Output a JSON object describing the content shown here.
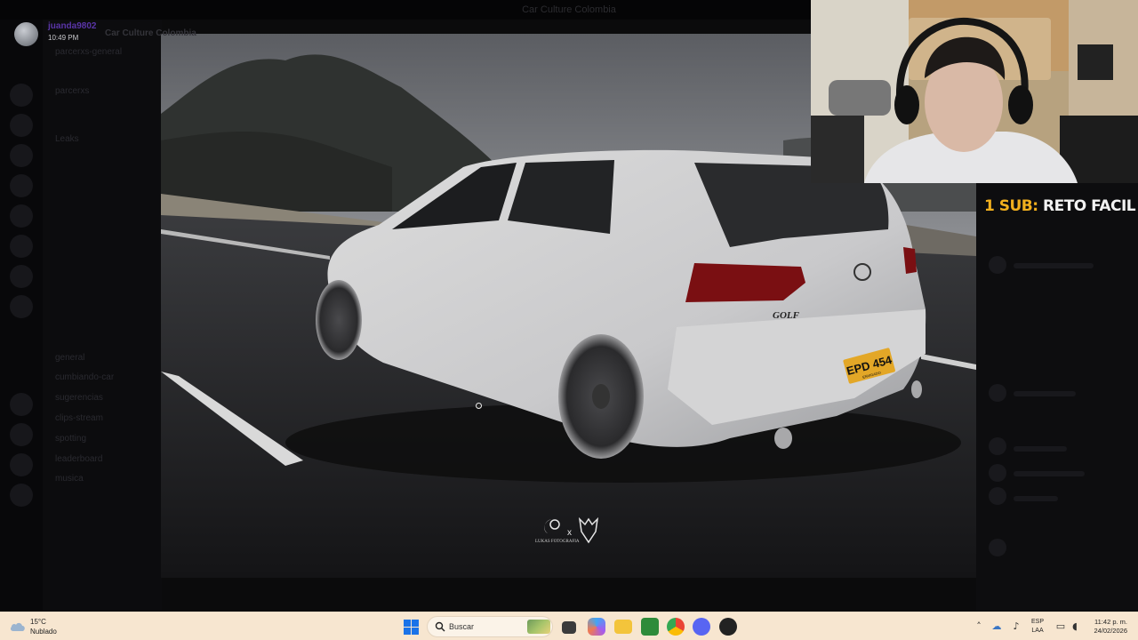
{
  "app": {
    "window_title": "Car Culture Colombia",
    "server_name": "Car Culture Colombia"
  },
  "user_header": {
    "username": "juanda9802",
    "time": "10:49 PM"
  },
  "channels": [
    "parcerxs-general",
    "parcerxs",
    "Leaks",
    "general",
    "cumbiando-car",
    "sugerencias",
    "clips-stream",
    "spotting",
    "leaderboard",
    "musica"
  ],
  "stream_overlay": {
    "sub_count": "1 SUB:",
    "sub_goal": "RETO FACIL"
  },
  "photo": {
    "watermark_left": "LUKAS\nFOTOGRAFIA",
    "watermark_sep": "x",
    "plate": "EPD 454",
    "plate_city": "ENVIGADO",
    "badge": "GOLF"
  },
  "taskbar": {
    "weather_temp": "15°C",
    "weather_desc": "Nublado",
    "search_placeholder": "Buscar",
    "lang_top": "ESP",
    "lang_bottom": "LAA",
    "clock_time": "11:42 p. m.",
    "clock_date": "24/02/2026",
    "apps": [
      "file-explorer",
      "copilot",
      "folder",
      "xbox",
      "chrome",
      "discord",
      "obs"
    ]
  },
  "colors": {
    "sub_count": "#f2b01e",
    "username": "#5a35a8",
    "taskbar_bg": "#f7e6d0",
    "plate_yellow": "#e3a727"
  }
}
